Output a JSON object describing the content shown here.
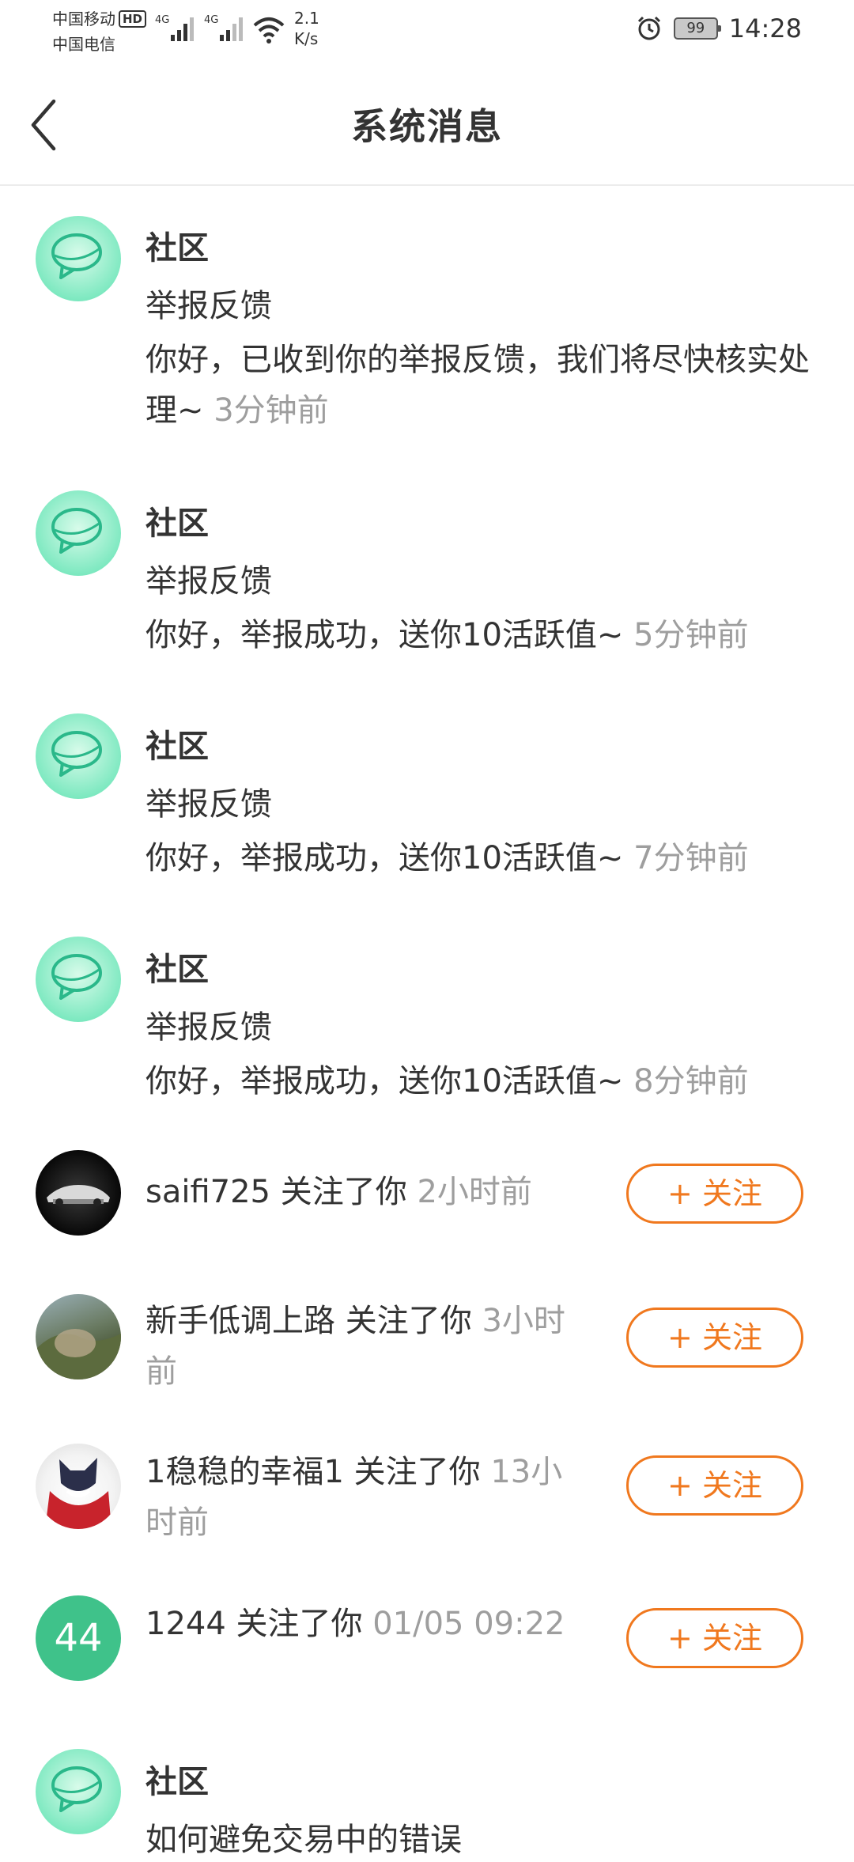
{
  "status_bar": {
    "carrier1": "中国移动",
    "carrier2": "中国电信",
    "hd": "HD",
    "net1": "4G",
    "net2": "4G",
    "speed_value": "2.1",
    "speed_unit": "K/s",
    "battery": "99",
    "time": "14:28"
  },
  "header": {
    "title": "系统消息"
  },
  "messages": [
    {
      "sender": "社区",
      "subject": "举报反馈",
      "text": "你好，已收到你的举报反馈，我们将尽快核实处理~ ",
      "time": "3分钟前"
    },
    {
      "sender": "社区",
      "subject": "举报反馈",
      "text": "你好，举报成功，送你10活跃值~ ",
      "time": "5分钟前"
    },
    {
      "sender": "社区",
      "subject": "举报反馈",
      "text": "你好，举报成功，送你10活跃值~ ",
      "time": "7分钟前"
    },
    {
      "sender": "社区",
      "subject": "举报反馈",
      "text": "你好，举报成功，送你10活跃值~ ",
      "time": "8分钟前"
    }
  ],
  "follows": [
    {
      "user": "saifi725",
      "action": " 关注了你 ",
      "time": "2小时前",
      "button": "+ 关注"
    },
    {
      "user": "新手低调上路",
      "action": " 关注了你 ",
      "time": "3小时前",
      "button": "+ 关注"
    },
    {
      "user": "1稳稳的幸福1",
      "action": " 关注了你 ",
      "time": "13小时前",
      "button": "+ 关注"
    },
    {
      "user": "1244",
      "action": " 关注了你 ",
      "time": "01/05 09:22",
      "button": "+ 关注",
      "avatar_text": "44"
    }
  ],
  "last_message": {
    "sender": "社区",
    "subject": "如何避免交易中的错误"
  },
  "colors": {
    "accent_orange": "#f0781e",
    "time_gray": "#9e9e9e",
    "avatar_green": "#3fc28a",
    "chat_avatar_mint": "#7fe9c1"
  },
  "icons": {
    "back": "chevron-left-icon",
    "chat": "chat-bubble-icon",
    "alarm": "alarm-icon",
    "wifi": "wifi-icon",
    "signal": "signal-icon"
  }
}
